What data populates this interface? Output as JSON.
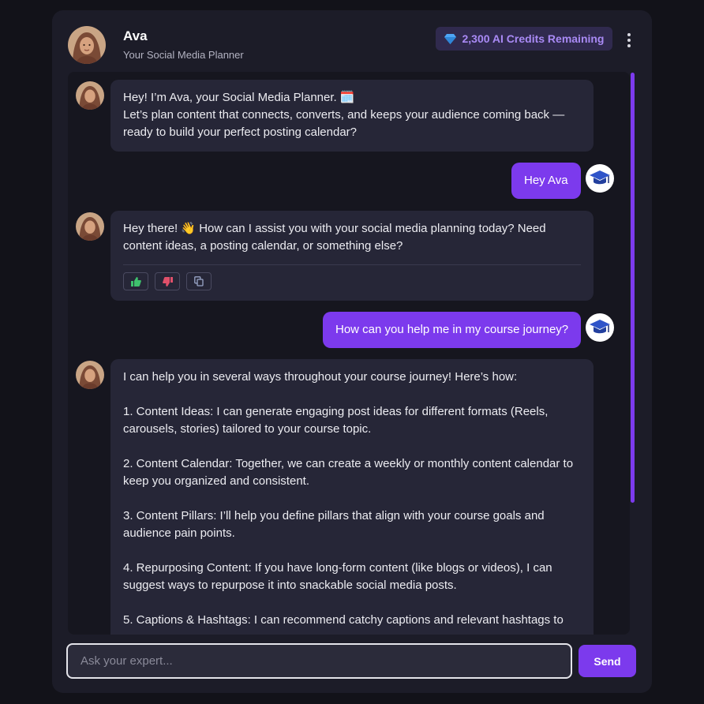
{
  "header": {
    "bot_name": "Ava",
    "bot_role": "Your Social Media Planner",
    "credits_label": "2,300  AI Credits Remaining",
    "icons": {
      "credits": "diamond-icon",
      "menu": "more-vertical-icon"
    }
  },
  "messages": [
    {
      "sender": "bot",
      "lines": [
        "Hey! I’m Ava, your Social Media Planner. 🗓️",
        "Let’s plan content that connects, converts, and keeps your audience coming back — ready to build your perfect posting calendar?"
      ]
    },
    {
      "sender": "user",
      "text": "Hey Ava"
    },
    {
      "sender": "bot",
      "text": "Hey there!  👋 How can I assist you with your social media planning today? Need content ideas, a posting calendar, or something else?",
      "actions": [
        "thumbs-up-icon",
        "thumbs-down-icon",
        "copy-icon"
      ]
    },
    {
      "sender": "user",
      "text": "How can you help me in my course journey?"
    },
    {
      "sender": "bot",
      "paragraphs": [
        "I can help you in several ways throughout your course journey! Here’s how:",
        "1. Content Ideas: I can generate engaging post ideas for different formats (Reels, carousels, stories) tailored to your course topic.",
        "2. Content Calendar: Together, we can create a weekly or monthly content calendar to keep you organized and consistent.",
        "3. Content Pillars: I’ll help you define pillars that align with your course goals and audience pain points.",
        "4. Repurposing Content: If you have long-form content (like blogs or videos), I can suggest ways to repurpose it into snackable social media posts.",
        "5. Captions & Hashtags: I can recommend catchy captions and relevant hashtags to"
      ]
    }
  ],
  "composer": {
    "placeholder": "Ask your expert...",
    "send_label": "Send"
  },
  "colors": {
    "accent": "#7c3aed",
    "credits_text": "#a98af5",
    "background": "#121219",
    "panel": "#1c1c28",
    "bubble": "#262637"
  }
}
